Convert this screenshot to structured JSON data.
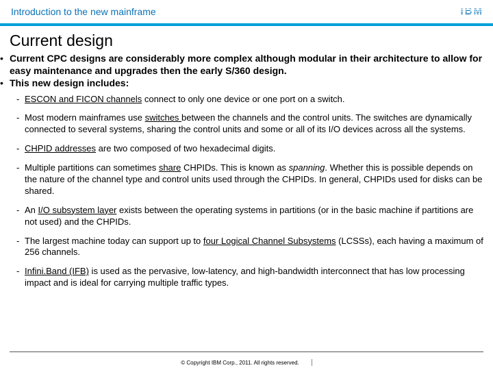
{
  "header": {
    "title": "Introduction to the new mainframe",
    "logo_name": "ibm-logo"
  },
  "slide": {
    "title": "Current design",
    "top_bullets": [
      "Current CPC designs are considerably more complex although modular in their architecture to allow for easy maintenance and upgrades then the early S/360 design.",
      "This new design includes:"
    ],
    "sub_bullets": [
      {
        "pre": "",
        "u1": "ESCON and FICON channels",
        "mid": " connect to only one device or one port on a switch.",
        "u2": "",
        "post": ""
      },
      {
        "pre": "Most modern mainframes use ",
        "u1": "switches ",
        "mid": "between the channels and the control units. The switches are dynamically connected to several systems, sharing the control units and some or all of its I/O devices across all the systems.",
        "u2": "",
        "post": ""
      },
      {
        "pre": "",
        "u1": "CHPID addresses",
        "mid": " are two composed of two hexadecimal digits.",
        "u2": "",
        "post": ""
      },
      {
        "pre": "Multiple partitions can sometimes ",
        "u1": "share",
        "mid": " CHPIDs. This is known as ",
        "u2": "",
        "post": "spanning",
        "post_italic": true,
        "after_post": ". Whether this is possible depends on the nature of the channel type and control units used through the CHPIDs. In general, CHPIDs used for disks can be shared."
      },
      {
        "pre": "An ",
        "u1": "I/O subsystem layer",
        "mid": " exists between the operating systems in partitions (or in the basic machine if partitions are not used) and the CHPIDs.",
        "u2": "",
        "post": ""
      },
      {
        "pre": "The largest machine today can support up to ",
        "u1": "four Logical Channel Subsystems",
        "mid": " (LCSSs), each having a maximum of 256 channels.",
        "u2": "",
        "post": ""
      },
      {
        "pre": "",
        "u1": "Infini.Band (IFB)",
        "mid": " is used as the pervasive, low-latency, and high-bandwidth interconnect that has low processing impact and is ideal for carrying multiple traffic types.",
        "u2": "",
        "post": ""
      }
    ]
  },
  "footer": {
    "copyright": "© Copyright IBM Corp., 2011. All rights reserved."
  }
}
